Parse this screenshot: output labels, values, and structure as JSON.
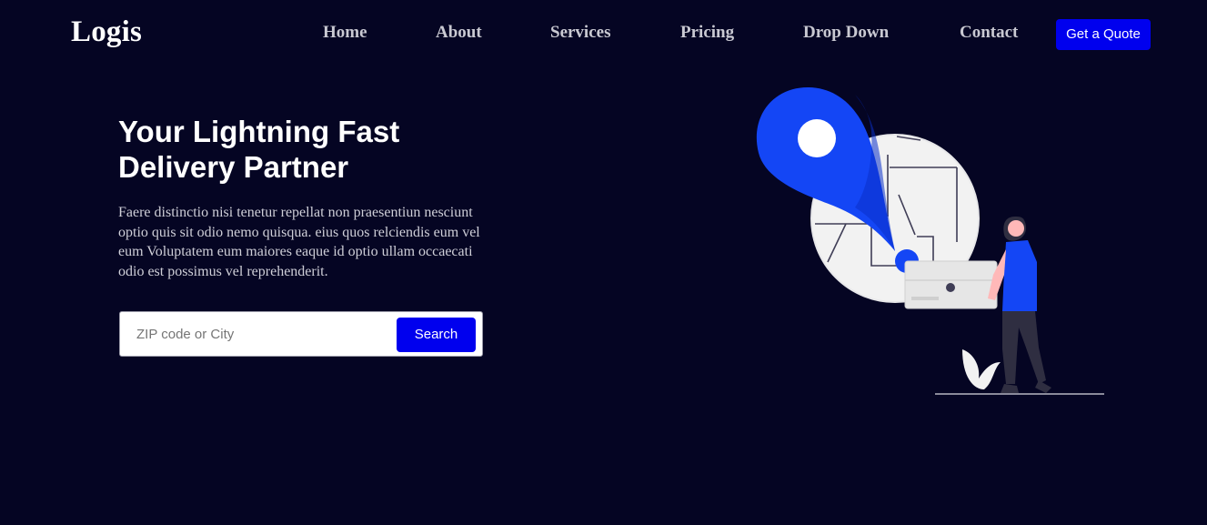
{
  "brand": {
    "logo_text": "Logis"
  },
  "nav": {
    "links": [
      "Home",
      "About",
      "Services",
      "Pricing",
      "Drop Down",
      "Contact"
    ],
    "cta_label": "Get a Quote"
  },
  "hero": {
    "title_lines": [
      "Your Lightning Fast",
      "Delivery Partner"
    ],
    "description_lines": [
      "Faere distinctio nisi tenetur repellat non praesentiun nesciunt",
      "optio quis sit odio nemo quisqua. eius quos relciendis eum vel",
      "eum Voluptatem eum maiores eaque id optio ullam occaecati",
      "odio est possimus vel reprehenderit."
    ]
  },
  "search": {
    "placeholder": "ZIP code or City",
    "value": "",
    "button_label": "Search"
  },
  "colors": {
    "background": "#050523",
    "accent": "#0000ee",
    "pin_blue": "#1446f5"
  },
  "illustration": {
    "icon": "delivery-person-map-pin-illustration"
  }
}
